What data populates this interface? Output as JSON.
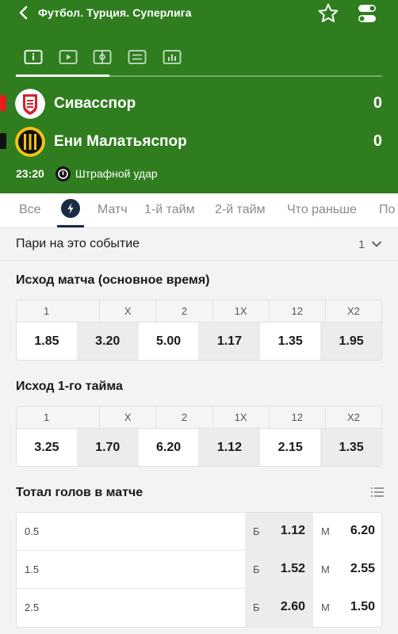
{
  "header": {
    "title": "Футбол. Турция. Суперлига",
    "colors": {
      "background": "#2f7d1f",
      "red_card": "#e41e1e",
      "black_card": "#111111"
    }
  },
  "teams": [
    {
      "name": "Сивасспор",
      "score": "0",
      "card": "red-card"
    },
    {
      "name": "Ени Малатьяспор",
      "score": "0",
      "card": "black-card"
    }
  ],
  "event": {
    "time": "23:20",
    "text": "Штрафной удар"
  },
  "tabs": {
    "items": [
      "Все",
      "Матч",
      "1-й тайм",
      "2-й тайм",
      "Что раньше",
      "По"
    ],
    "active_icon": "lightning-icon"
  },
  "bets": {
    "title": "Пари на это событие",
    "count": "1"
  },
  "match_result": {
    "title": "Исход матча (основное время)",
    "headers": [
      "1",
      "X",
      "2",
      "1X",
      "12",
      "X2"
    ],
    "values": [
      "1.85",
      "3.20",
      "5.00",
      "1.17",
      "1.35",
      "1.95"
    ]
  },
  "first_half": {
    "title": "Исход 1-го тайма",
    "headers": [
      "1",
      "X",
      "2",
      "1X",
      "12",
      "X2"
    ],
    "values": [
      "3.25",
      "1.70",
      "6.20",
      "1.12",
      "2.15",
      "1.35"
    ]
  },
  "total": {
    "title": "Тотал голов в матче",
    "rows": [
      {
        "line": "0.5",
        "over_label": "Б",
        "over": "1.12",
        "under_label": "М",
        "under": "6.20"
      },
      {
        "line": "1.5",
        "over_label": "Б",
        "over": "1.52",
        "under_label": "М",
        "under": "2.55"
      },
      {
        "line": "2.5",
        "over_label": "Б",
        "over": "2.60",
        "under_label": "М",
        "under": "1.50"
      }
    ]
  }
}
